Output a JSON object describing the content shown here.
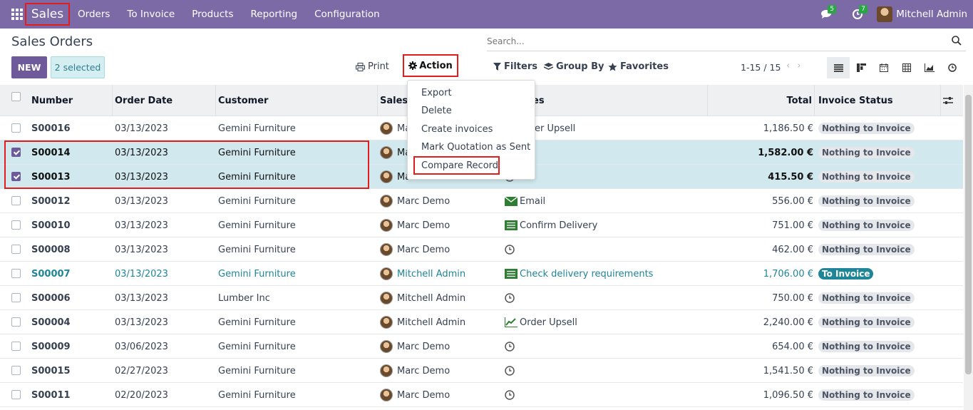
{
  "navbar": {
    "app_name": "Sales",
    "menu": [
      "Orders",
      "To Invoice",
      "Products",
      "Reporting",
      "Configuration"
    ],
    "messages_count": "5",
    "activities_count": "7",
    "user_name": "Mitchell Admin"
  },
  "control_panel": {
    "title": "Sales Orders",
    "search_placeholder": "Search...",
    "new_label": "NEW",
    "selected_label": "2 selected",
    "print_label": "Print",
    "action_label": "Action",
    "filters_label": "Filters",
    "group_by_label": "Group By",
    "favorites_label": "Favorites",
    "pager": "1-15 / 15"
  },
  "action_menu": [
    "Export",
    "Delete",
    "Create invoices",
    "Mark Quotation as Sent",
    "Compare Record"
  ],
  "table": {
    "columns": [
      "Number",
      "Order Date",
      "Customer",
      "Salesp",
      "es",
      "Total",
      "Invoice Status"
    ],
    "rows": [
      {
        "number": "S00016",
        "date": "03/13/2023",
        "customer": "Gemini Furniture",
        "salesperson": "Ma",
        "activity": "er Upsell",
        "total": "1,186.50 €",
        "status": "Nothing to Invoice"
      },
      {
        "number": "S00014",
        "date": "03/13/2023",
        "customer": "Gemini Furniture",
        "salesperson": "Ma",
        "activity": "",
        "total": "1,582.00 €",
        "status": "Nothing to Invoice"
      },
      {
        "number": "S00013",
        "date": "03/13/2023",
        "customer": "Gemini Furniture",
        "salesperson": "Ma",
        "activity": "",
        "total": "415.50 €",
        "status": "Nothing to Invoice"
      },
      {
        "number": "S00012",
        "date": "03/13/2023",
        "customer": "Gemini Furniture",
        "salesperson": "Marc Demo",
        "activity": "Email",
        "total": "556.00 €",
        "status": "Nothing to Invoice"
      },
      {
        "number": "S00010",
        "date": "03/13/2023",
        "customer": "Gemini Furniture",
        "salesperson": "Marc Demo",
        "activity": "Confirm Delivery",
        "total": "751.00 €",
        "status": "Nothing to Invoice"
      },
      {
        "number": "S00008",
        "date": "03/13/2023",
        "customer": "Gemini Furniture",
        "salesperson": "Marc Demo",
        "activity": "",
        "total": "462.00 €",
        "status": "Nothing to Invoice"
      },
      {
        "number": "S00007",
        "date": "03/13/2023",
        "customer": "Gemini Furniture",
        "salesperson": "Mitchell Admin",
        "activity": "Check delivery requirements",
        "total": "1,706.00 €",
        "status": "To Invoice"
      },
      {
        "number": "S00006",
        "date": "03/13/2023",
        "customer": "Lumber Inc",
        "salesperson": "Mitchell Admin",
        "activity": "",
        "total": "750.00 €",
        "status": "Nothing to Invoice"
      },
      {
        "number": "S00004",
        "date": "03/13/2023",
        "customer": "Gemini Furniture",
        "salesperson": "Mitchell Admin",
        "activity": "Order Upsell",
        "total": "2,240.00 €",
        "status": "Nothing to Invoice"
      },
      {
        "number": "S00009",
        "date": "03/06/2023",
        "customer": "Gemini Furniture",
        "salesperson": "Marc Demo",
        "activity": "",
        "total": "654.00 €",
        "status": "Nothing to Invoice"
      },
      {
        "number": "S00015",
        "date": "02/27/2023",
        "customer": "Gemini Furniture",
        "salesperson": "Marc Demo",
        "activity": "",
        "total": "1,541.50 €",
        "status": "Nothing to Invoice"
      },
      {
        "number": "S00011",
        "date": "02/20/2023",
        "customer": "Gemini Furniture",
        "salesperson": "Marc Demo",
        "activity": "",
        "total": "1,096.50 €",
        "status": "Nothing to Invoice"
      }
    ]
  },
  "colors": {
    "navbar": "#7b6aa6",
    "primary": "#6e5a9b",
    "teal": "#1f8599",
    "highlight": "#e11d1d"
  }
}
